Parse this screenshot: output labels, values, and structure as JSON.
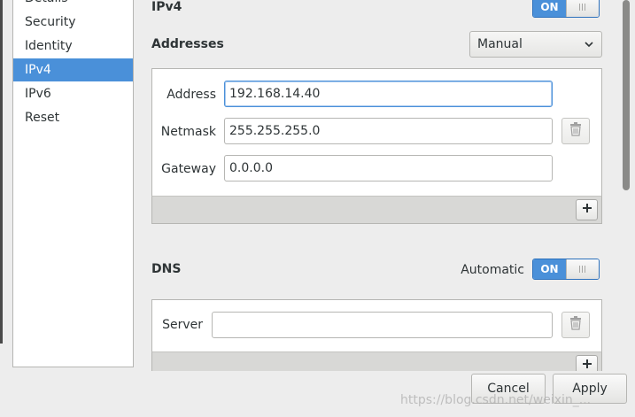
{
  "sidebar": {
    "items": [
      {
        "label": "Details"
      },
      {
        "label": "Security"
      },
      {
        "label": "Identity"
      },
      {
        "label": "IPv4"
      },
      {
        "label": "IPv6"
      },
      {
        "label": "Reset"
      }
    ],
    "selected": "IPv4"
  },
  "ipv4": {
    "title": "IPv4",
    "toggle_label": "ON"
  },
  "addresses": {
    "title": "Addresses",
    "method": "Manual",
    "address_label": "Address",
    "address_value": "192.168.14.40",
    "netmask_label": "Netmask",
    "netmask_value": "255.255.255.0",
    "gateway_label": "Gateway",
    "gateway_value": "0.0.0.0"
  },
  "dns": {
    "title": "DNS",
    "automatic_label": "Automatic",
    "toggle_label": "ON",
    "server_label": "Server",
    "server_value": ""
  },
  "footer": {
    "cancel_label": "Cancel",
    "apply_label": "Apply"
  },
  "watermark": "https://blog.csdn.net/weixin_..."
}
